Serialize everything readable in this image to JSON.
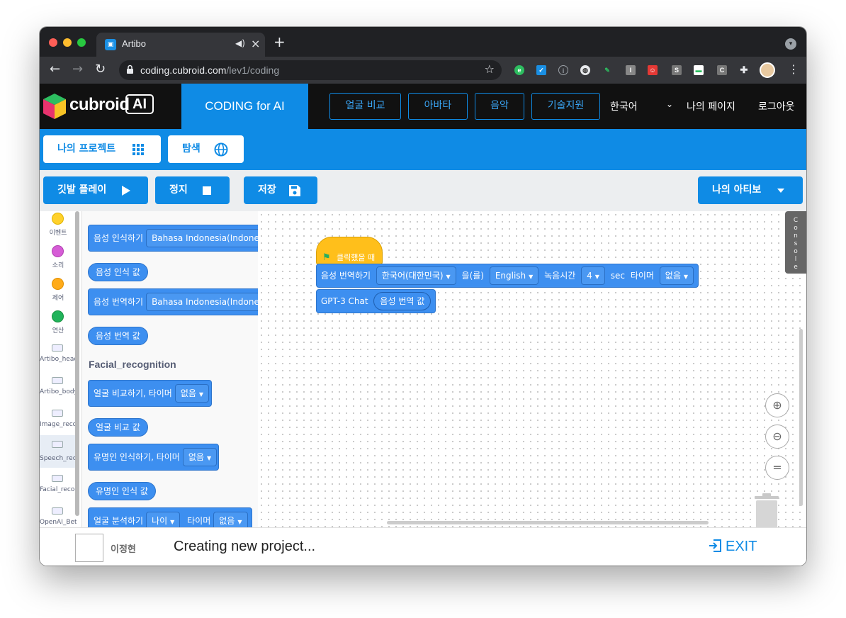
{
  "browser": {
    "tab_title": "Artibo",
    "url_host": "coding.cubroid.com",
    "url_path": "/lev1/coding"
  },
  "header": {
    "logo_text": "cubroid",
    "logo_ai": "AI",
    "coding_tab": "CODING for AI",
    "buttons": [
      "얼굴 비교",
      "아바타",
      "음악",
      "기술지원"
    ],
    "language": "한국어",
    "mypage": "나의 페이지",
    "logout": "로그아웃"
  },
  "bluebar": {
    "my_projects": "나의 프로젝트",
    "explore": "탐색"
  },
  "controls": {
    "play": "깃발 플레이",
    "stop": "정지",
    "save": "저장",
    "device": "나의 아티보"
  },
  "categories": [
    {
      "label": "이벤트",
      "color": "#ffd12b"
    },
    {
      "label": "소리",
      "color": "#d65cd6"
    },
    {
      "label": "제어",
      "color": "#ffab19"
    },
    {
      "label": "연산",
      "color": "#22b35b"
    },
    {
      "label": "Artibo_head"
    },
    {
      "label": "Artibo_body"
    },
    {
      "label": "Image_recogn"
    },
    {
      "label": "Speech_recog"
    },
    {
      "label": "Facial_recogni"
    },
    {
      "label": "OpenAI_Beta"
    }
  ],
  "palette": {
    "speech_recognize": "음성 인식하기",
    "speech_lang": "Bahasa Indonesia(Indonesia",
    "speech_value": "음성 인식 값",
    "speech_translate": "음성 번역하기",
    "translate_lang": "Bahasa Indonesia(Indonesia",
    "translate_value": "음성 번역 값",
    "section_facial": "Facial_recognition",
    "face_compare": "얼굴 비교하기, 타이머",
    "face_compare_dd": "없음",
    "face_compare_value": "얼굴 비교 값",
    "celeb": "유명인 인식하기, 타이머",
    "celeb_dd": "없음",
    "celeb_value": "유명인 인식 값",
    "face_analyze": "얼굴 분석하기",
    "face_analyze_dd": "나이",
    "face_analyze_timer": "타이머",
    "face_analyze_timer_dd": "없음"
  },
  "script": {
    "hat": "클릭했을 때",
    "translate_label": "음성 번역하기",
    "from_lang": "한국어(대한민국)",
    "to_word": "을(를)",
    "to_lang": "English",
    "rec_time": "녹음시간",
    "rec_value": "4",
    "sec": "sec",
    "timer": "타이머",
    "timer_value": "없음",
    "gpt": "GPT-3 Chat",
    "gpt_input": "음성 번역 값"
  },
  "console_label": "Console",
  "footer": {
    "username": "이정현",
    "status": "Creating new project...",
    "exit": "EXIT"
  }
}
